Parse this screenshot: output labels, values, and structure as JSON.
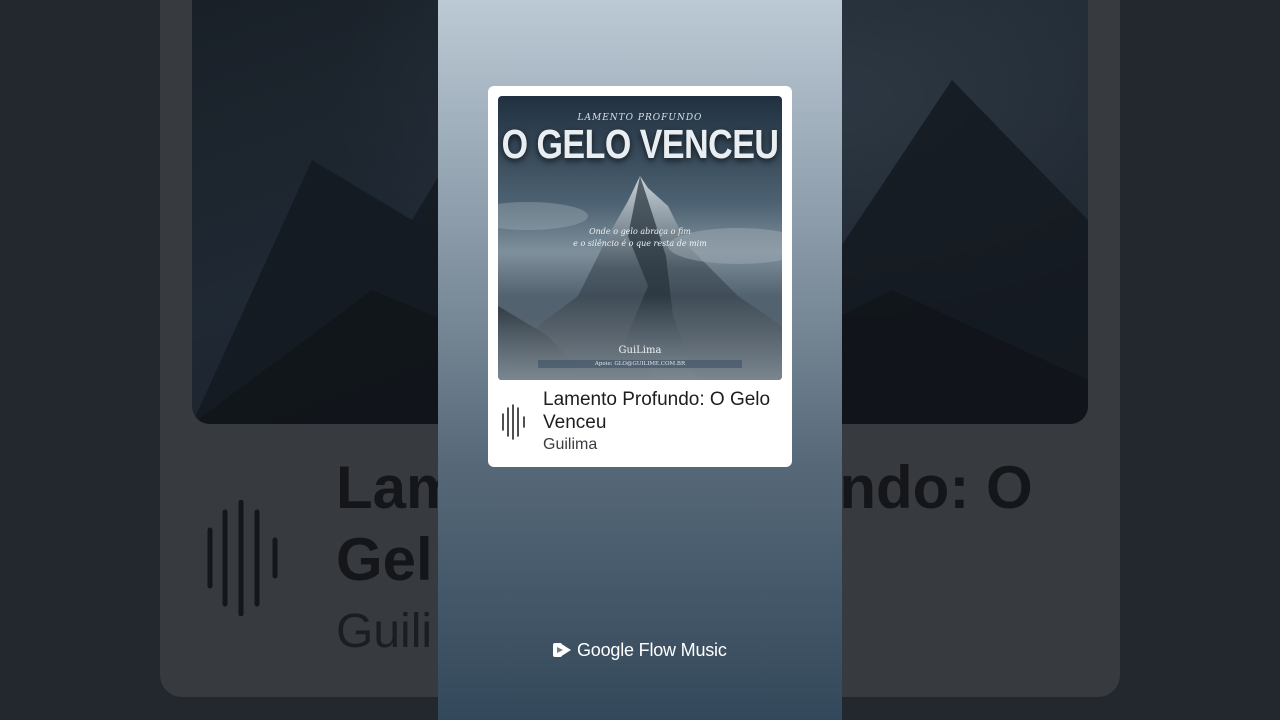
{
  "track": {
    "title": "Lamento Profundo: O Gelo Venceu",
    "artist": "Guilima"
  },
  "cover": {
    "kicker": "LAMENTO PROFUNDO",
    "title": "O GELO VENCEU",
    "subtitle_line1": "Onde o gelo abraça o fim",
    "subtitle_line2": "e o silêncio é o que resta de mim",
    "artist": "GuiLima",
    "contact": "Apoie: GLO@GUILIME.COM.BR"
  },
  "background": {
    "title_fragment_1": "Lam",
    "title_fragment_2": "ndo: O",
    "title_fragment_3": "Gel",
    "artist_fragment": "Guili"
  },
  "brand": {
    "name": "Google Flow Music",
    "icon": "play-flow-icon"
  },
  "colors": {
    "panel_top": "#bccad5",
    "panel_bottom": "#33485a",
    "card": "#ffffff",
    "title_text": "#1b1d20"
  }
}
